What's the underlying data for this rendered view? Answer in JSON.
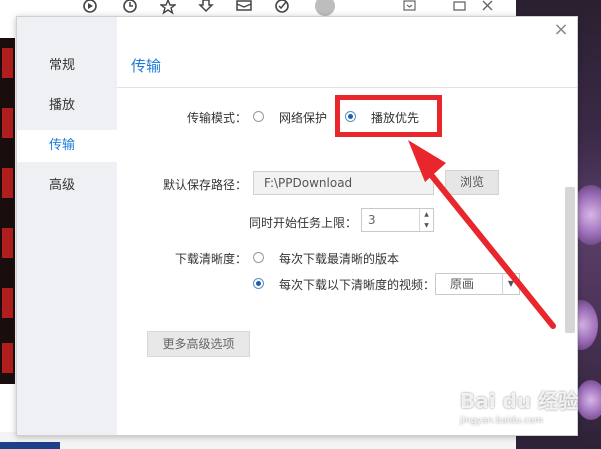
{
  "sidebar": {
    "items": [
      {
        "label": "常规"
      },
      {
        "label": "播放"
      },
      {
        "label": "传输"
      },
      {
        "label": "高级"
      }
    ]
  },
  "dialog": {
    "close_glyph": "×",
    "section_title": "传输"
  },
  "transfer_mode": {
    "label": "传输模式：",
    "options": [
      {
        "label": "网络保护",
        "checked": false
      },
      {
        "label": "播放优先",
        "checked": true
      }
    ]
  },
  "save_path": {
    "label": "默认保存路径：",
    "value": "F:\\PPDownload",
    "browse_label": "浏览"
  },
  "task_limit": {
    "label": "同时开始任务上限：",
    "value": "3"
  },
  "download_quality": {
    "label": "下载清晰度：",
    "options": [
      {
        "label": "每次下载最清晰的版本",
        "checked": false
      },
      {
        "label": "每次下载以下清晰度的视频：",
        "checked": true
      }
    ],
    "selected": "原画"
  },
  "more_options_label": "更多高级选项",
  "watermark": {
    "main": "Bai du 经验",
    "sub": "jingyan.baidu.com"
  },
  "colors": {
    "accent": "#1d7ad6",
    "highlight": "#e8262c"
  },
  "icons": {
    "toolbar": [
      "play-icon",
      "history-icon",
      "favorite-icon",
      "download-icon",
      "mail-icon",
      "clean-icon",
      "avatar"
    ],
    "window_controls": [
      "menu-icon",
      "maximize-icon",
      "close-icon"
    ]
  }
}
